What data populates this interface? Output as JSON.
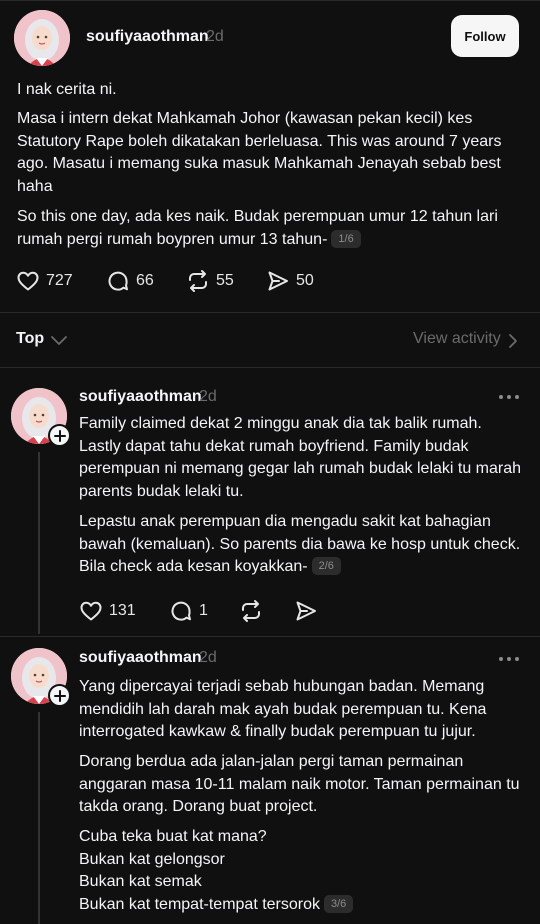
{
  "main_post": {
    "username": "soufiyaaothman",
    "time": "2d",
    "follow_label": "Follow",
    "p1": "I nak cerita ni.",
    "p2": "Masa i intern dekat Mahkamah Johor (kawasan pekan kecil) kes Statutory Rape boleh dikatakan berleluasa. This was around 7 years ago. Masatu i memang suka masuk Mahkamah Jenayah sebab best haha",
    "p3": "So this one day, ada kes naik. Budak perempuan umur 12 tahun lari rumah pergi rumah boypren umur 13 tahun-",
    "page": "1/6",
    "likes": "727",
    "comments": "66",
    "reposts": "55",
    "shares": "50"
  },
  "sort_bar": {
    "label": "Top",
    "view_activity": "View activity"
  },
  "replies": [
    {
      "username": "soufiyaaothman",
      "time": "2d",
      "p1": "Family claimed dekat 2 minggu anak dia tak balik rumah. Lastly dapat tahu dekat rumah boyfriend. Family budak perempuan ni memang gegar lah rumah budak lelaki tu marah parents budak lelaki tu.",
      "p2": "Lepastu anak perempuan dia mengadu sakit kat bahagian bawah (kemaluan). So parents dia bawa ke hosp untuk check. Bila check ada kesan koyakkan-",
      "page": "2/6",
      "likes": "131",
      "comments": "1"
    },
    {
      "username": "soufiyaaothman",
      "time": "2d",
      "p1": "Yang dipercayai terjadi sebab hubungan badan. Memang mendidih lah darah mak ayah budak perempuan tu. Kena interrogated kawkaw & finally budak perempuan tu jujur.",
      "p2": "Dorang berdua ada jalan-jalan pergi taman permainan anggaran masa 10-11 malam naik motor. Taman permainan tu takda orang. Dorang buat project.",
      "lines": [
        "Cuba teka buat kat mana?",
        "Bukan kat gelongsor",
        "Bukan kat semak",
        "Bukan kat tempat-tempat tersorok"
      ],
      "page": "3/6"
    }
  ],
  "icons": [
    "heart-icon",
    "comment-icon",
    "repost-icon",
    "share-icon",
    "chevron-down-icon",
    "chevron-right-icon",
    "more-icon",
    "plus-icon"
  ],
  "colors": {
    "background": "#101010",
    "text": "#f3f5f7",
    "muted": "#6b6b6b",
    "badge_bg": "#2c2c2c"
  }
}
